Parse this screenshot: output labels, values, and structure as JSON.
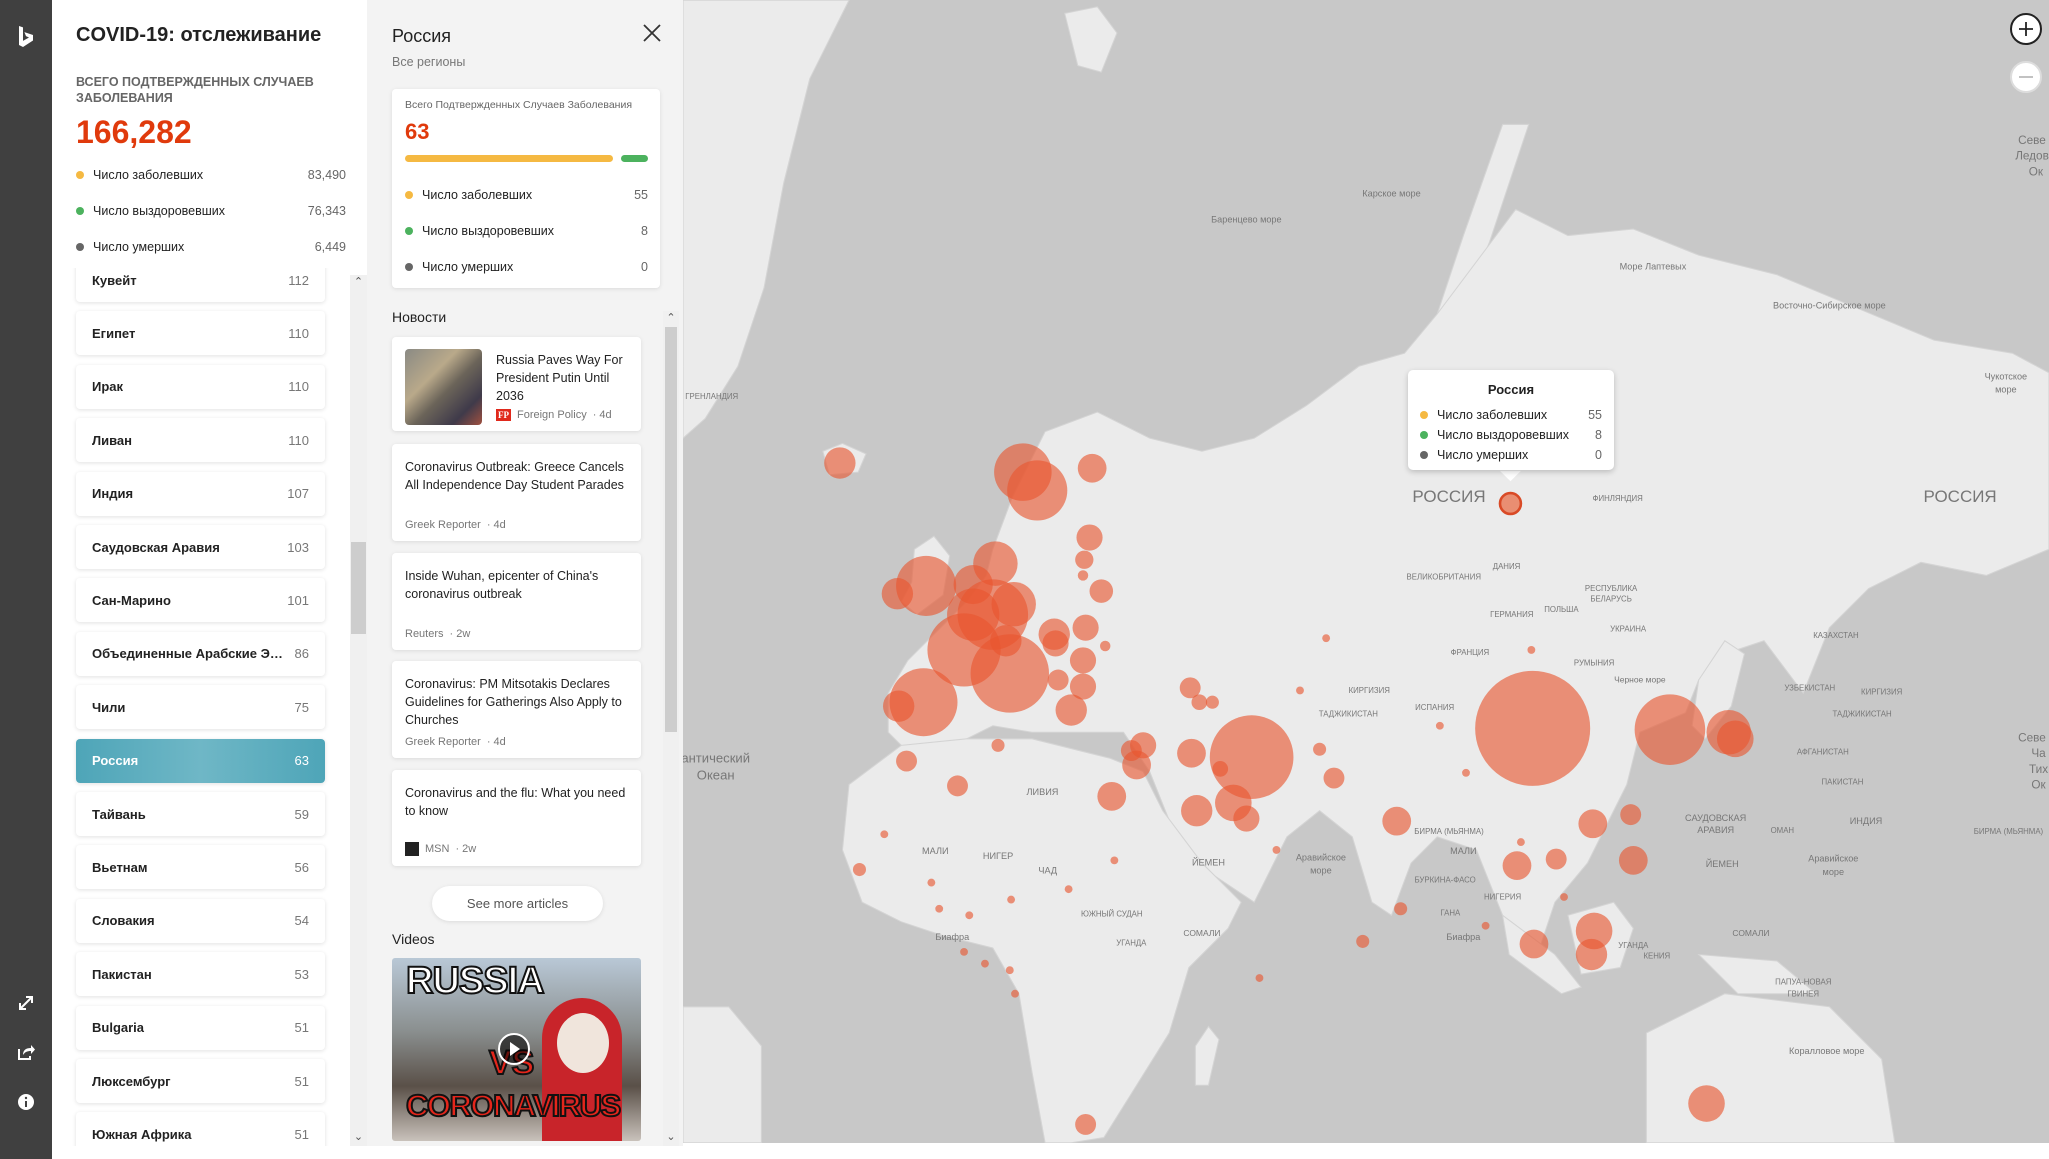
{
  "app": {
    "title": "COVID-19: отслеживание",
    "total_label": "ВСЕГО ПОДТВЕРЖДЕННЫХ СЛУЧАЕВ ЗАБОЛЕВАНИЯ",
    "total": "166,282",
    "stats": [
      {
        "label": "Число заболевших",
        "value": "83,490",
        "color": "#f5b942"
      },
      {
        "label": "Число выздоровевших",
        "value": "76,343",
        "color": "#4cb25e"
      },
      {
        "label": "Число умерших",
        "value": "6,449",
        "color": "#666666"
      }
    ]
  },
  "countries": [
    {
      "name": "Кувейт",
      "count": "112"
    },
    {
      "name": "Египет",
      "count": "110"
    },
    {
      "name": "Ирак",
      "count": "110"
    },
    {
      "name": "Ливан",
      "count": "110"
    },
    {
      "name": "Индия",
      "count": "107"
    },
    {
      "name": "Саудовская Аравия",
      "count": "103"
    },
    {
      "name": "Сан-Марино",
      "count": "101"
    },
    {
      "name": "Объединенные Арабские Эмираты",
      "count": "86"
    },
    {
      "name": "Чили",
      "count": "75"
    },
    {
      "name": "Россия",
      "count": "63",
      "selected": true
    },
    {
      "name": "Тайвань",
      "count": "59"
    },
    {
      "name": "Вьетнам",
      "count": "56"
    },
    {
      "name": "Словакия",
      "count": "54"
    },
    {
      "name": "Пакистан",
      "count": "53"
    },
    {
      "name": "Bulgaria",
      "count": "51"
    },
    {
      "name": "Люксембург",
      "count": "51"
    },
    {
      "name": "Южная Африка",
      "count": "51"
    }
  ],
  "detail": {
    "title": "Россия",
    "subtitle": "Все регионы",
    "card_label": "Всего Подтвержденных Случаев Заболевания",
    "total": "63",
    "progress": {
      "active_fraction": 0.873,
      "recovered_fraction": 0.127,
      "deaths_fraction": 0
    },
    "stats": [
      {
        "label": "Число заболевших",
        "value": "55"
      },
      {
        "label": "Число выздоровевших",
        "value": "8"
      },
      {
        "label": "Число умерших",
        "value": "0"
      }
    ],
    "news_heading": "Новости",
    "news": [
      {
        "headline": "Russia Paves Way For President Putin Until 2036",
        "source": "Foreign Policy",
        "age": "· 4d",
        "logo": "FP"
      },
      {
        "headline": "Coronavirus Outbreak: Greece Cancels All Independence Day Student Parades",
        "source": "Greek Reporter",
        "age": "· 4d"
      },
      {
        "headline": "Inside Wuhan, epicenter of China's coronavirus outbreak",
        "source": "Reuters",
        "age": "· 2w"
      },
      {
        "headline": "Coronavirus: PM Mitsotakis Declares Guidelines for Gatherings Also Apply to Churches",
        "source": "Greek Reporter",
        "age": "· 4d"
      },
      {
        "headline": "Coronavirus and the flu: What you need to know",
        "source": "MSN",
        "age": "· 2w"
      }
    ],
    "see_more": "See more articles",
    "videos_heading": "Videos",
    "video": {
      "overlay_top": "RUSSIA",
      "overlay_mid": "VS",
      "overlay_bottom": "CORONAVIRUS"
    }
  },
  "tooltip": {
    "title": "Россия",
    "rows": [
      {
        "label": "Число заболевших",
        "value": "55"
      },
      {
        "label": "Число выздоровевших",
        "value": "8"
      },
      {
        "label": "Число умерших",
        "value": "0"
      }
    ]
  },
  "map": {
    "labels": [
      "Карское море",
      "Баренцево море",
      "Море Лаптевых",
      "Восточно-Сибирское море",
      "Чукотское",
      "море",
      "ГРЕНЛАНДИЯ",
      "РОССИЯ",
      "РОССИЯ",
      "ФИНЛЯНДИЯ",
      "ДАНИЯ",
      "ВЕЛИКОБРИТАНИЯ",
      "РЕСПУБЛИКА",
      "БЕЛАРУСЬ",
      "ГЕРМАНИЯ",
      "ПОЛЬША",
      "УКРАИНА",
      "КАЗАХСТАН",
      "ФРАНЦИЯ",
      "РУМЫНИЯ",
      "Черное море",
      "УЗБЕКИСТАН",
      "КИРГИЗИЯ",
      "КИРГИЗИЯ",
      "ИСПАНИЯ",
      "ТАДЖИКИСТАН",
      "ТАДЖИКИСТАН",
      "АФГАНИСТАН",
      "антический",
      "Океан",
      "ПАКИСТАН",
      "ЛИВИЯ",
      "САУДОВСКАЯ",
      "АРАВИЯ",
      "ИНДИЯ",
      "ОМАН",
      "БИРМА (МЬЯНМА)",
      "БИРМА (МЬЯНМА)",
      "МАЛИ",
      "НИГЕР",
      "ЧАД",
      "ЙЕМЕН",
      "ЙЕМЕН",
      "Аравийское",
      "море",
      "Аравийское",
      "море",
      "МАЛИ",
      "БУРКИНА-ФАСО",
      "НИГЕРИЯ",
      "ЮЖНЫЙ СУДАН",
      "ГАНА",
      "СОМАЛИ",
      "СОМАЛИ",
      "Биафра",
      "Биафра",
      "УГАНДА",
      "УГАНДА",
      "КЕНИЯ",
      "ПАПУА-НОВАЯ",
      "ГВИНЕЯ",
      "Коралловое море",
      "Севе",
      "Ледов",
      "Ок",
      "Севе",
      "Ча",
      "Тих",
      "Ок"
    ],
    "bubble_color": "#e8552f"
  }
}
